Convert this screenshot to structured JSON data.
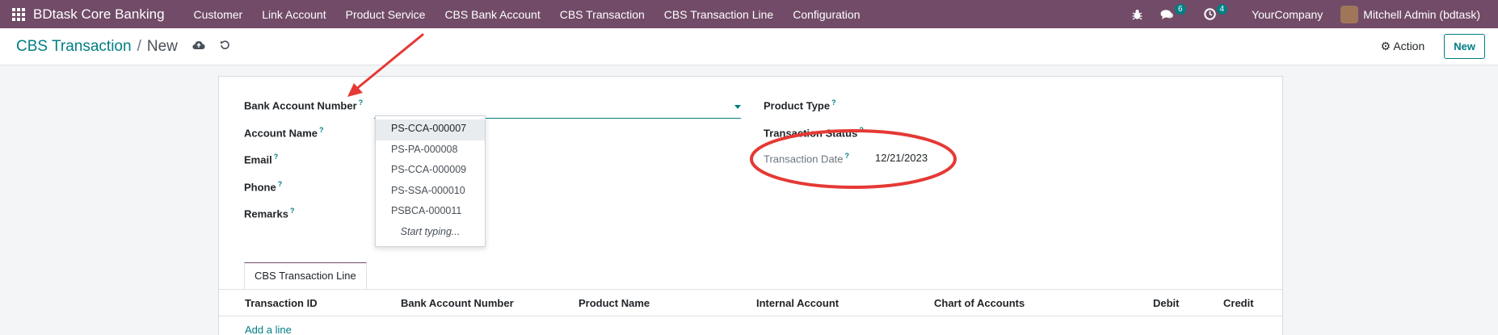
{
  "navbar": {
    "brand": "BDtask Core Banking",
    "menu": [
      "Customer",
      "Link Account",
      "Product Service",
      "CBS Bank Account",
      "CBS Transaction",
      "CBS Transaction Line",
      "Configuration"
    ],
    "messages_count": "6",
    "activities_count": "4",
    "company": "YourCompany",
    "user": "Mitchell Admin (bdtask)"
  },
  "breadcrumb": {
    "parent": "CBS Transaction",
    "separator": "/",
    "current": "New"
  },
  "actions": {
    "action_label": "Action",
    "new_label": "New"
  },
  "form": {
    "help_mark": "?",
    "left_fields": [
      "Bank Account Number",
      "Account Name",
      "Email",
      "Phone",
      "Remarks"
    ],
    "right_fields": [
      "Product Type",
      "Transaction Status"
    ],
    "transaction_date": {
      "label": "Transaction Date",
      "value": "12/21/2023"
    },
    "dropdown": {
      "options": [
        "PS-CCA-000007",
        "PS-PA-000008",
        "PS-CCA-000009",
        "PS-SSA-000010",
        "PSBCA-000011"
      ],
      "hint": "Start typing..."
    }
  },
  "tabs": {
    "active": "CBS Transaction Line"
  },
  "lines_table": {
    "columns": [
      "Transaction ID",
      "Bank Account Number",
      "Product Name",
      "Internal Account",
      "Chart of Accounts",
      "Debit",
      "Credit"
    ],
    "add_line": "Add a line"
  },
  "colors": {
    "brand": "#714b67",
    "accent": "#017e84",
    "annotation": "#e53935"
  }
}
